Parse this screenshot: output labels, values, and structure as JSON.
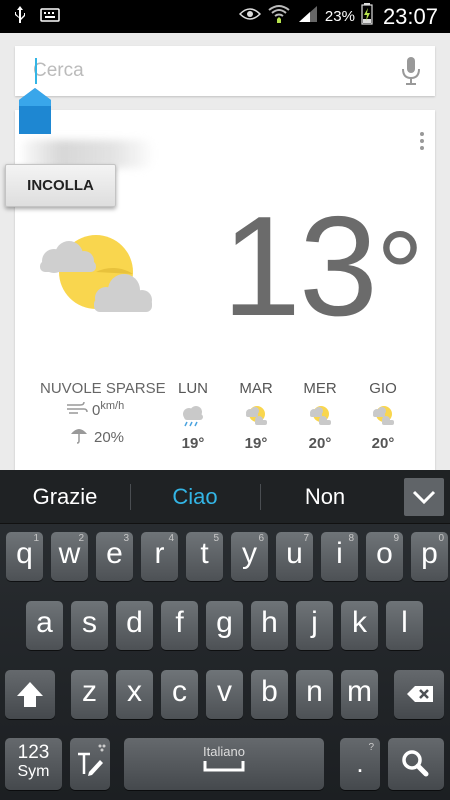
{
  "status_bar": {
    "battery": "23%",
    "time": "23:07"
  },
  "search": {
    "placeholder": "Cerca",
    "value": ""
  },
  "context_menu": {
    "paste_label": "INCOLLA"
  },
  "weather": {
    "temperature": "13",
    "degree_symbol": "°",
    "condition": "NUVOLE SPARSE",
    "wind_value": "0",
    "wind_unit": "km/h",
    "precipitation": "20%",
    "forecast": [
      {
        "day": "LUN",
        "temp": "19°",
        "icon": "rain-cloud-icon"
      },
      {
        "day": "MAR",
        "temp": "19°",
        "icon": "partly-cloudy-icon"
      },
      {
        "day": "MER",
        "temp": "20°",
        "icon": "partly-cloudy-icon"
      },
      {
        "day": "GIO",
        "temp": "20°",
        "icon": "partly-cloudy-icon"
      }
    ]
  },
  "keyboard": {
    "suggestions": [
      "Grazie",
      "Ciao",
      "Non"
    ],
    "row1": [
      {
        "k": "q",
        "n": "1"
      },
      {
        "k": "w",
        "n": "2"
      },
      {
        "k": "e",
        "n": "3"
      },
      {
        "k": "r",
        "n": "4"
      },
      {
        "k": "t",
        "n": "5"
      },
      {
        "k": "y",
        "n": "6"
      },
      {
        "k": "u",
        "n": "7"
      },
      {
        "k": "i",
        "n": "8"
      },
      {
        "k": "o",
        "n": "9"
      },
      {
        "k": "p",
        "n": "0"
      }
    ],
    "row2": [
      "a",
      "s",
      "d",
      "f",
      "g",
      "h",
      "j",
      "k",
      "l"
    ],
    "row3": [
      "z",
      "x",
      "c",
      "v",
      "b",
      "n",
      "m"
    ],
    "sym_top": "123",
    "sym_bottom": "Sym",
    "space_label": "Italiano",
    "period": ".",
    "period_hint": "?"
  },
  "colors": {
    "accent": "#33b5e5",
    "sun": "#f9d64e",
    "cloud": "#cfcfcf",
    "temp_text": "#6b6b6b"
  }
}
